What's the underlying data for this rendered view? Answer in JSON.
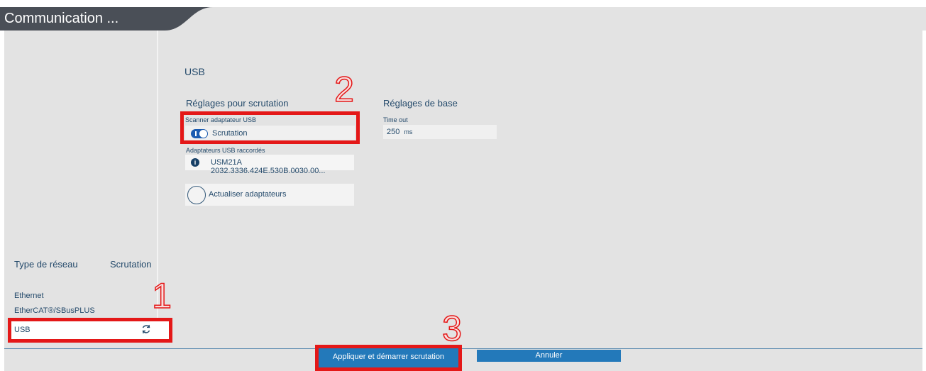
{
  "window": {
    "title": "Communication ..."
  },
  "sidebar": {
    "header_type": "Type de réseau",
    "header_scan": "Scrutation",
    "items": [
      {
        "label": "Ethernet"
      },
      {
        "label": "EtherCAT®/SBusPLUS"
      },
      {
        "label": "USB",
        "icon": "refresh-icon",
        "selected": true
      }
    ]
  },
  "main": {
    "section_title": "USB",
    "scan_settings": {
      "title": "Réglages pour scrutation",
      "scanner_label": "Scanner adaptateur USB",
      "toggle_label": "Scrutation",
      "toggle_on": true,
      "adapters_label": "Adaptateurs USB raccordés",
      "adapter_value": "USM21A 2032.3336.424E.530B.0030.00...",
      "refresh_label": "Actualiser adaptateurs"
    },
    "base_settings": {
      "title": "Réglages de base",
      "timeout_label": "Time out",
      "timeout_value": "250",
      "timeout_unit": "ms"
    }
  },
  "footer": {
    "apply_label": "Appliquer et démarrer scrutation",
    "cancel_label": "Annuler"
  },
  "annotations": [
    "1",
    "2",
    "3"
  ],
  "colors": {
    "highlight": "#e41818",
    "button": "#2379ba",
    "titlebar": "#4a4f57",
    "text": "#244a6b"
  }
}
